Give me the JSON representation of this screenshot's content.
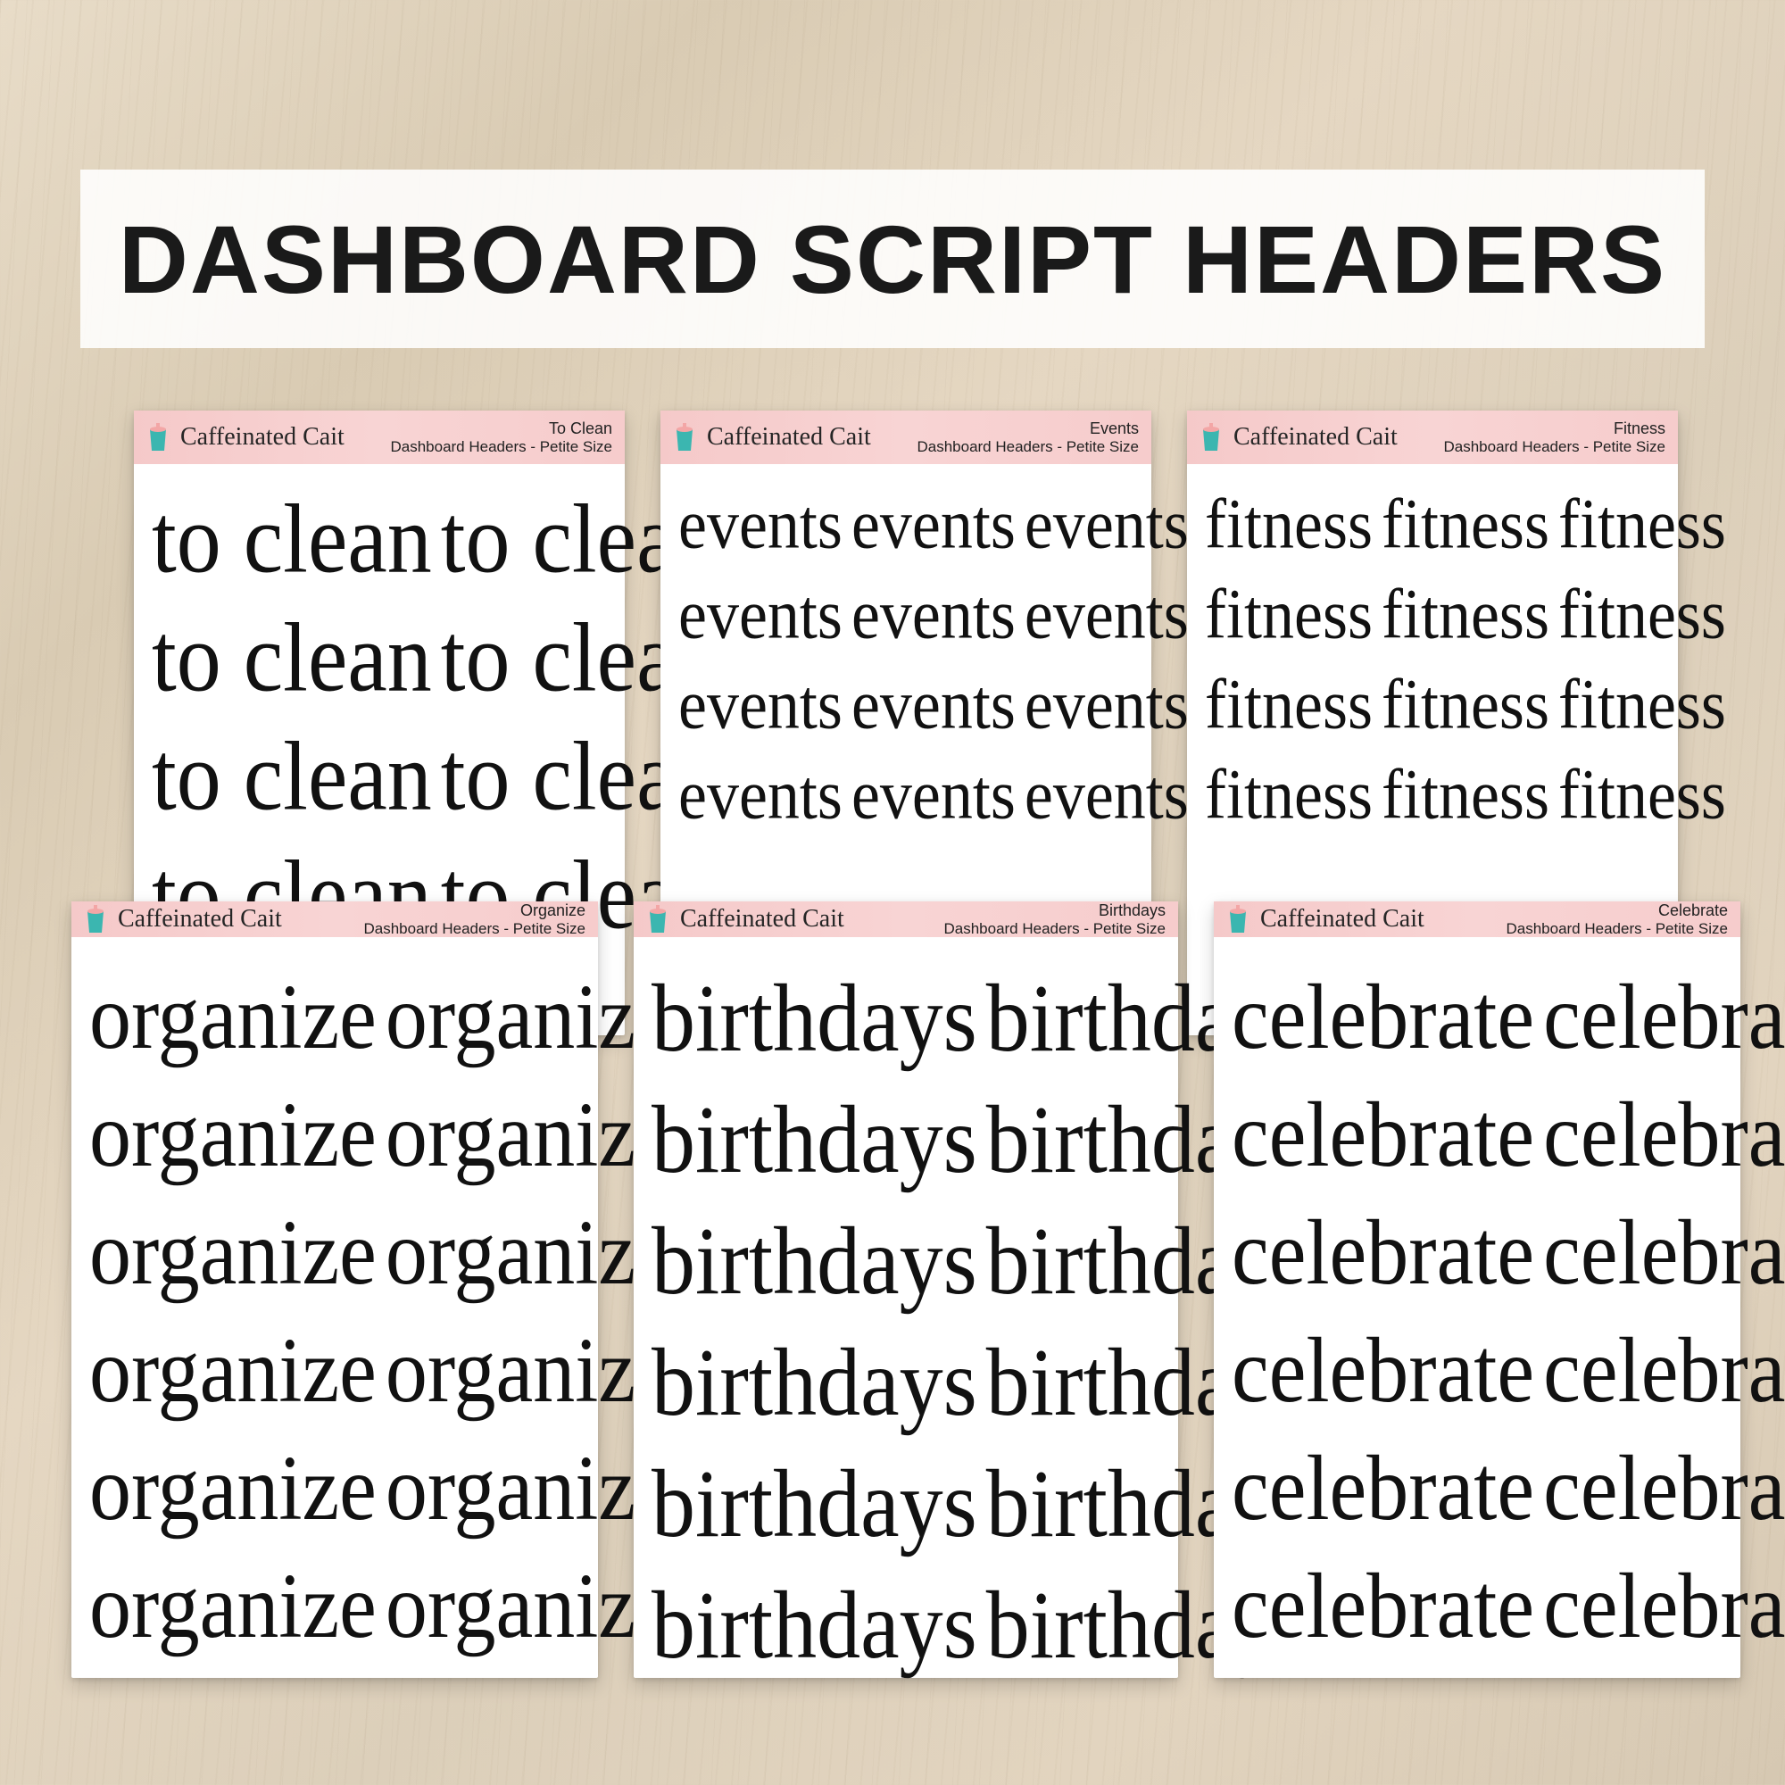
{
  "title": "DASHBOARD SCRIPT HEADERS",
  "brand": "Caffeinated Cait",
  "subtitle": "Dashboard Headers - Petite Size",
  "sheets": {
    "toclean": {
      "title": "To Clean",
      "word": "to clean",
      "cols": 2,
      "rows": 4
    },
    "events": {
      "title": "Events",
      "word": "events",
      "cols": 3,
      "rows": 4
    },
    "fitness": {
      "title": "Fitness",
      "word": "fitness",
      "cols": 3,
      "rows": 4
    },
    "organize": {
      "title": "Organize",
      "word": "organize",
      "cols": 2,
      "rows": 6
    },
    "birthdays": {
      "title": "Birthdays",
      "word": "birthdays",
      "cols": 2,
      "rows": 6
    },
    "celebrate": {
      "title": "Celebrate",
      "word": "celebrate",
      "cols": 2,
      "rows": 6
    }
  }
}
